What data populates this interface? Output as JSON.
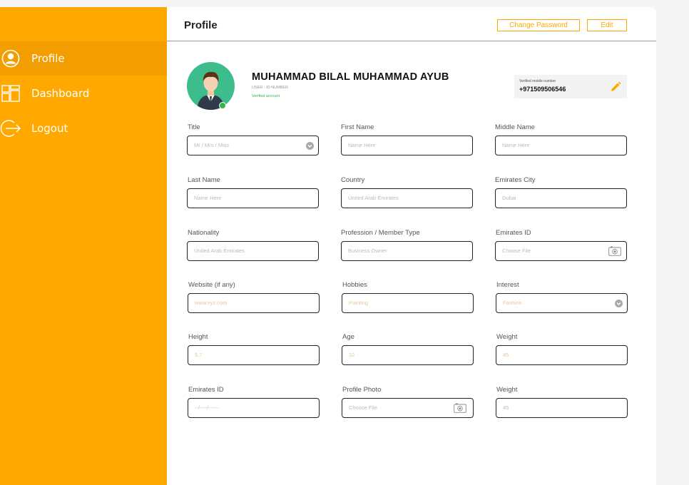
{
  "sidebar": {
    "items": [
      {
        "label": "Profile",
        "icon": "user-circle-icon",
        "active": true
      },
      {
        "label": "Dashboard",
        "icon": "dashboard-grid-icon",
        "active": false
      },
      {
        "label": "Logout",
        "icon": "logout-icon",
        "active": false
      }
    ]
  },
  "header": {
    "title": "Profile",
    "change_password_label": "Change Password",
    "edit_label": "Edit"
  },
  "user": {
    "name": "MUHAMMAD BILAL MUHAMMAD AYUB",
    "id_label": "USER - ID NUMBER",
    "verified_label": "Verified account"
  },
  "mobile": {
    "label": "Verified mobile number",
    "number": "+971509506546"
  },
  "fields": {
    "title": {
      "label": "Title",
      "placeholder": "Mr / Mrs / Miss"
    },
    "first_name": {
      "label": "First Name",
      "placeholder": "Name Here"
    },
    "middle_name": {
      "label": "Middle Name",
      "placeholder": "Name Here"
    },
    "last_name": {
      "label": "Last Name",
      "placeholder": "Name Here"
    },
    "country": {
      "label": "Country",
      "placeholder": "United Arab Emirates"
    },
    "emirates_city": {
      "label": "Emirates City",
      "placeholder": "Dubai"
    },
    "nationality": {
      "label": "Nationality",
      "placeholder": "United Arab Emirates"
    },
    "profession": {
      "label": "Profession / Member Type",
      "placeholder": "Business Owner"
    },
    "emirates_id": {
      "label": "Emirates ID",
      "placeholder": "Choose File"
    },
    "website": {
      "label": "Website (if any)",
      "placeholder": "www.xyz.com"
    },
    "hobbies": {
      "label": "Hobbies",
      "placeholder": "Painting"
    },
    "interest": {
      "label": "Interest",
      "placeholder": "Fashion"
    },
    "height": {
      "label": "Height",
      "placeholder": "5.7"
    },
    "age": {
      "label": "Age",
      "placeholder": "32"
    },
    "weight": {
      "label": "Weight",
      "placeholder": "45"
    },
    "emirates_id_2": {
      "label": "Emirates ID",
      "placeholder": "--/----/------"
    },
    "profile_photo": {
      "label": "Profile Photo",
      "placeholder": "Choose File"
    },
    "weight_2": {
      "label": "Weight",
      "placeholder": "45"
    }
  },
  "colors": {
    "accent": "#FFA800",
    "active_nav": "#F29E00",
    "avatar_bg": "#3dbd8c",
    "verified": "#37b34a"
  }
}
